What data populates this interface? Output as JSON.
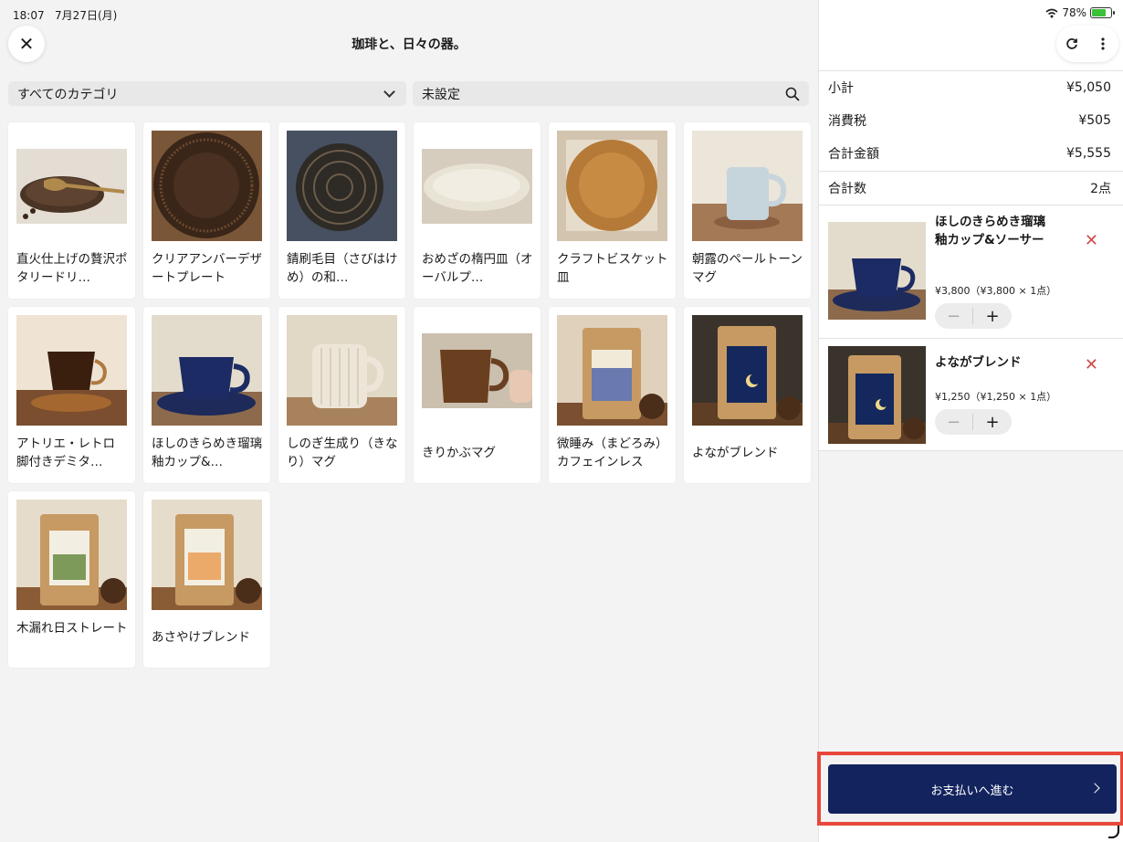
{
  "status": {
    "time": "18:07",
    "date": "7月27日(月)",
    "battery": "78%",
    "battery_level": 0.78
  },
  "header": {
    "title": "珈琲と、日々の器。",
    "close_icon": "close-icon"
  },
  "filters": {
    "category": "すべてのカテゴリ",
    "search_value": "未設定"
  },
  "products": [
    {
      "name": "直火仕上げの贅沢ポタリードリ…",
      "lines": 2
    },
    {
      "name": "クリアアンバーデザートプレート",
      "lines": 2
    },
    {
      "name": "錆刷毛目（さびはけめ）の和…",
      "lines": 2
    },
    {
      "name": "おめざの楕円皿（オーバルプ…",
      "lines": 2
    },
    {
      "name": "クラフトビスケット皿",
      "lines": 2
    },
    {
      "name": "朝露のペールトーンマグ",
      "lines": 2
    },
    {
      "name": "アトリエ・レトロ 脚付きデミタ…",
      "lines": 2
    },
    {
      "name": "ほしのきらめき瑠璃釉カップ&…",
      "lines": 2
    },
    {
      "name": "しのぎ生成り（きなり）マグ",
      "lines": 2
    },
    {
      "name": "きりかぶマグ",
      "lines": 1
    },
    {
      "name": "微睡み（まどろみ）カフェインレス",
      "lines": 2
    },
    {
      "name": "よながブレンド",
      "lines": 1
    },
    {
      "name": "木漏れ日ストレート",
      "lines": 2
    },
    {
      "name": "あさやけブレンド",
      "lines": 1
    }
  ],
  "cart": {
    "subtotal_label": "小計",
    "subtotal": "¥5,050",
    "tax_label": "消費税",
    "tax": "¥505",
    "total_label": "合計金額",
    "total": "¥5,555",
    "count_label": "合計数",
    "count": "2点",
    "items": [
      {
        "name": "ほしのきらめき瑠璃釉カップ&ソーサー",
        "price": "¥3,800（¥3,800 × 1点）"
      },
      {
        "name": "よながブレンド",
        "price": "¥1,250（¥1,250 × 1点）"
      }
    ],
    "pay_label": "お支払いへ進む"
  }
}
